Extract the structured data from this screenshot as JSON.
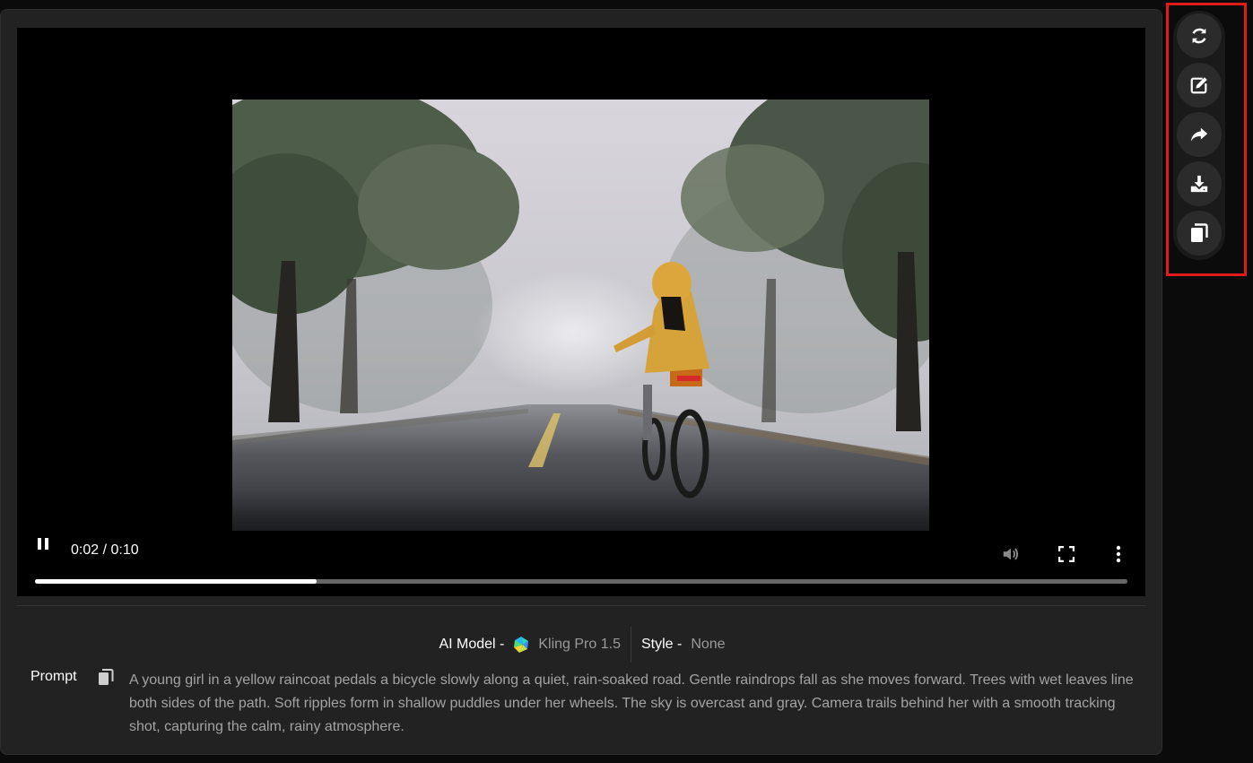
{
  "player": {
    "time_display": "0:02 / 0:10",
    "progress_fraction": 0.258
  },
  "meta": {
    "model_label": "AI Model -",
    "model_value": "Kling Pro 1.5",
    "style_label": "Style -",
    "style_value": "None"
  },
  "prompt": {
    "label": "Prompt",
    "text": "A young girl in a yellow raincoat pedals a bicycle slowly along a quiet, rain-soaked road. Gentle raindrops fall as she moves forward. Trees with wet leaves line both sides of the path. Soft ripples form in shallow puddles under her wheels. The sky is overcast and gray. Camera trails behind her with a smooth tracking shot, capturing the calm, rainy atmosphere."
  },
  "actions": [
    {
      "name": "regenerate",
      "icon": "refresh-icon"
    },
    {
      "name": "edit",
      "icon": "edit-icon"
    },
    {
      "name": "share",
      "icon": "share-icon"
    },
    {
      "name": "download",
      "icon": "download-icon"
    },
    {
      "name": "copy",
      "icon": "copy-icon"
    }
  ],
  "colors": {
    "highlight": "#e01b1b",
    "card_bg": "#222222"
  }
}
